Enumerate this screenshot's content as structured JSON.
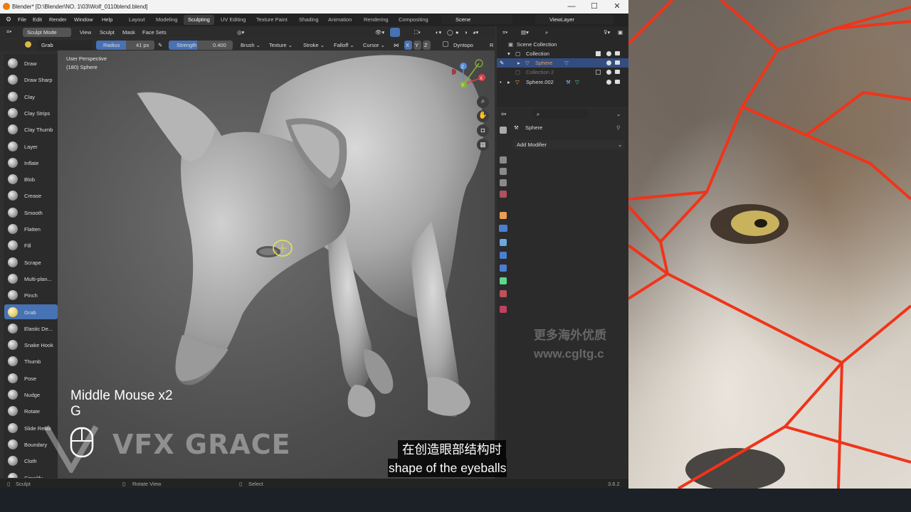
{
  "window": {
    "title": "Blender* [D:\\Blender\\NO. 1\\03\\Wolf_0110blend.blend]",
    "minimize": "—",
    "maximize": "☐",
    "close": "✕"
  },
  "menubar": {
    "menus": [
      "File",
      "Edit",
      "Render",
      "Window",
      "Help"
    ],
    "workspaces": [
      "Layout",
      "Modeling",
      "Sculpting",
      "UV Editing",
      "Texture Paint",
      "Shading",
      "Animation",
      "Rendering",
      "Compositing"
    ],
    "active_workspace": "Sculpting",
    "scene": "Scene",
    "view_layer": "ViewLayer"
  },
  "header": {
    "mode": "Sculpt Mode",
    "menus": [
      "View",
      "Sculpt",
      "Mask",
      "Face Sets"
    ]
  },
  "tool_settings": {
    "brush_name": "Grab",
    "radius_label": "Radius",
    "radius_value": "41 px",
    "strength_label": "Strength",
    "strength_value": "0.400",
    "dropdowns": [
      "Brush",
      "Texture",
      "Stroke",
      "Falloff",
      "Cursor"
    ],
    "axes": [
      "X",
      "Y",
      "Z"
    ],
    "dyntopo": "Dyntopo",
    "extra": "R"
  },
  "toolbar": {
    "tools": [
      "Draw",
      "Draw Sharp",
      "Clay",
      "Clay Strips",
      "Clay Thumb",
      "Layer",
      "Inflate",
      "Blob",
      "Crease",
      "Smooth",
      "Flatten",
      "Fill",
      "Scrape",
      "Multi-plan...",
      "Pinch",
      "Grab",
      "Elastic De...",
      "Snake Hook",
      "Thumb",
      "Pose",
      "Nudge",
      "Rotate",
      "Slide Relax",
      "Boundary",
      "Cloth",
      "Simplify"
    ],
    "selected": "Grab"
  },
  "viewport": {
    "view_name": "User Perspective",
    "object_info": "(180) Sphere",
    "gizmo_axes": [
      "Z",
      "Y",
      "X"
    ]
  },
  "outliner": {
    "scene_collection": "Scene Collection",
    "collection": "Collection",
    "sphere": "Sphere",
    "collection2": "Collection 2",
    "sphere002": "Sphere.002"
  },
  "properties": {
    "object_name": "Sphere",
    "add_modifier": "Add Modifier"
  },
  "status": {
    "left": "Sculpt",
    "middle": "Rotate View",
    "right": "Select",
    "version": "3.6.2"
  },
  "overlay": {
    "key_hint_line1": "Middle Mouse x2",
    "key_hint_line2": "G",
    "watermark": "VFX GRACE",
    "site_line1": "更多海外优质",
    "site_line2": "www.cgltg.c",
    "subtitle_zh": "在创造眼部结构时",
    "subtitle_en": "shape of the eyeballs"
  },
  "colors": {
    "accent_blue": "#4772b3",
    "blender_orange": "#e87d0d",
    "mesh_lines": "#f0341a"
  }
}
